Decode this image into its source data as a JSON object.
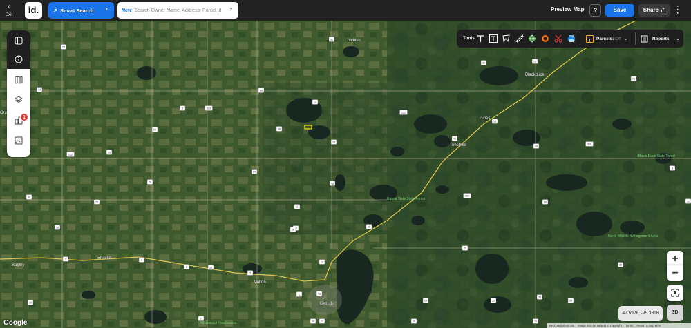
{
  "topbar": {
    "exit_label": "Exit",
    "logo_text": "id.",
    "smart_search_label": "Smart Search",
    "search_new_badge": "New",
    "search_placeholder": "Search Owner Name, Address, Parcel Id",
    "preview_label": "Preview Map",
    "help_label": "?",
    "save_label": "Save",
    "share_label": "Share"
  },
  "rail": {
    "items": [
      "panel-toggle",
      "info",
      "map",
      "layers",
      "buildings",
      "image-export"
    ],
    "badge_count": "1"
  },
  "tools": {
    "label": "Tools",
    "items": [
      "text-tool",
      "label-tool",
      "polygon-tool",
      "ruler-tool",
      "globe-tool",
      "buffer-tool",
      "scissors-tool",
      "print-tool"
    ],
    "parcels_label": "Parcels:",
    "parcels_state": "Off",
    "reports_label": "Reports"
  },
  "map": {
    "colors": {
      "terrain": "#3e5a2e",
      "water": "#1b2a22",
      "highway": "#d8c452",
      "highlight": "#f2e600"
    },
    "places": {
      "nebish": "Nebish",
      "blackduck": "Blackduck",
      "hines": "Hines",
      "tenstrike": "Tenstrike",
      "bagley": "Bagley",
      "shevlin": "Shevlin",
      "wilton": "Wilton",
      "bemidji": "Bemidji",
      "gro": "Gro",
      "black_duck_forest": "Black Duck State Forest",
      "buena_vista_forest": "Buena Vista State Forest",
      "north_wma": "North Wildlife Management Area",
      "mississippi_headwaters": "Mississippi Headwaters"
    },
    "shields": [
      "15",
      "32",
      "30",
      "71",
      "72",
      "14",
      "89",
      "13",
      "5",
      "513",
      "24",
      "26",
      "202",
      "16",
      "15",
      "222",
      "71",
      "25",
      "328",
      "15",
      "3",
      "89",
      "28",
      "15",
      "43",
      "15",
      "2",
      "22",
      "19",
      "307",
      "31",
      "30",
      "21",
      "9",
      "2",
      "2",
      "2",
      "16",
      "2",
      "20",
      "39",
      "12",
      "2",
      "71",
      "30",
      "7",
      "16",
      "14",
      "12",
      "33",
      "12",
      "12",
      "29",
      "24"
    ]
  },
  "controls": {
    "zoom_in": "+",
    "zoom_out": "−",
    "coordinates": "47.5926, -95.3316",
    "three_d": "3D"
  },
  "attribution": {
    "google": "Google",
    "keyboard": "Keyboard shortcuts",
    "imagery": "Image may be subject to copyright",
    "terms": "Terms",
    "report": "Report a map error"
  }
}
